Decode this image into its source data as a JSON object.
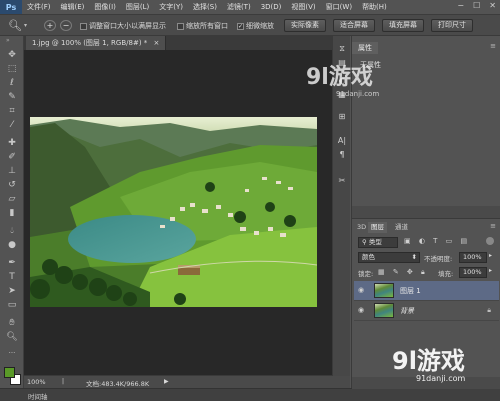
{
  "menubar": {
    "logo": "Ps",
    "items": [
      "文件(F)",
      "编辑(E)",
      "图像(I)",
      "图层(L)",
      "文字(Y)",
      "选择(S)",
      "滤镜(T)",
      "3D(D)",
      "视图(V)",
      "窗口(W)",
      "帮助(H)"
    ],
    "controls": [
      "−",
      "☐",
      "✕"
    ]
  },
  "options": {
    "resize_window": "调整窗口大小以满屏显示",
    "zoom_all": "缩放所有窗口",
    "scrubby": "细微缩放",
    "btn_actual": "实际像素",
    "btn_fit": "适合屏幕",
    "btn_fill": "填充屏幕",
    "btn_print": "打印尺寸"
  },
  "document": {
    "tab_title": "1.jpg @ 100% (图层 1, RGB/8#) *",
    "tab_close": "×"
  },
  "status": {
    "zoom": "100%",
    "doc_info": "文档:483.4K/966.8K",
    "arrow": "▶"
  },
  "timeline": {
    "label": "时间轴"
  },
  "properties": {
    "tab": "属性",
    "value": "无属性"
  },
  "layers": {
    "tabs": [
      "3D",
      "图层",
      "通道"
    ],
    "kind_filter": "类型",
    "blend_mode": "颜色",
    "opacity_label": "不透明度:",
    "opacity_value": "100%",
    "lock_label": "锁定:",
    "fill_label": "填充:",
    "fill_value": "100%",
    "rows": [
      {
        "name": "图层 1"
      },
      {
        "name": "背景"
      }
    ]
  },
  "watermark": {
    "logo": "9l游戏",
    "url": "91danji.com"
  },
  "colors": {
    "foreground": "#5a9a28",
    "background": "#ffffff"
  },
  "icons": {
    "toolbar": [
      "move-icon",
      "marquee-icon",
      "lasso-icon",
      "quick-select-icon",
      "crop-icon",
      "eyedropper-icon",
      "healing-icon",
      "brush-icon",
      "stamp-icon",
      "history-brush-icon",
      "eraser-icon",
      "gradient-icon",
      "blur-icon",
      "dodge-icon",
      "pen-icon",
      "type-icon",
      "path-select-icon",
      "shape-icon",
      "hand-icon",
      "zoom-icon"
    ]
  }
}
